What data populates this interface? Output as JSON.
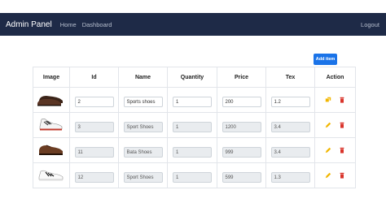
{
  "nav": {
    "brand": "Admin Panel",
    "home": "Home",
    "dashboard": "Dashboard",
    "logout": "Logout"
  },
  "add_button": "Add item",
  "table": {
    "headers": [
      "Image",
      "Id",
      "Name",
      "Quantity",
      "Price",
      "Tex",
      "Action"
    ],
    "rows": [
      {
        "image": "brown-dress-shoes-icon",
        "id": "2",
        "name": "Sports shoes",
        "quantity": "1",
        "price": "200",
        "tex": "1.2",
        "editable": true
      },
      {
        "image": "white-sport-shoe-icon",
        "id": "3",
        "name": "Sport Shoes",
        "quantity": "1",
        "price": "1200",
        "tex": "3.4",
        "editable": false
      },
      {
        "image": "brown-bata-shoe-icon",
        "id": "11",
        "name": "Bata Shoes",
        "quantity": "1",
        "price": "999",
        "tex": "3.4",
        "editable": false
      },
      {
        "image": "white-striped-sneaker-icon",
        "id": "12",
        "name": "Sport Shoes",
        "quantity": "1",
        "price": "599",
        "tex": "1.3",
        "editable": false
      }
    ]
  },
  "colors": {
    "navbar": "#1e2a47",
    "accent": "#1a73e8",
    "edit_icon": "#f2b600",
    "delete_icon": "#d9342b"
  }
}
